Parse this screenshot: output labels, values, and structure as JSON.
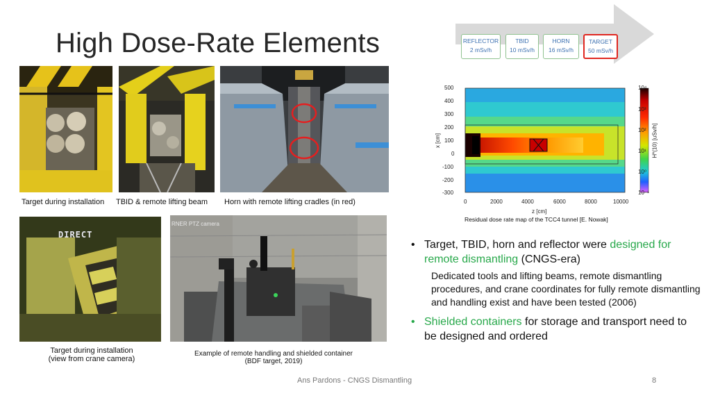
{
  "slide": {
    "title": "High Dose-Rate Elements",
    "footer_text": "Ans Pardons - CNGS Dismantling",
    "page_number": "8"
  },
  "photos": {
    "target_installation": {
      "caption": "Target during installation"
    },
    "tbid_beam": {
      "caption": "TBID & remote lifting beam"
    },
    "horn_cradles": {
      "caption": "Horn with remote lifting cradles (in red)"
    },
    "crane_camera": {
      "caption_line1": "Target during installation",
      "caption_line2": "(view from crane camera)",
      "overlay_text": "DIRECT"
    },
    "remote_handling": {
      "caption_line1": "Example of remote handling and shielded container",
      "caption_line2": "(BDF target, 2019)",
      "overlay_text": "RNER PTZ camera"
    }
  },
  "flow": {
    "stages": [
      {
        "name": "REFLECTOR",
        "dose": "2 mSv/h",
        "highlight": false
      },
      {
        "name": "TBID",
        "dose": "10 mSv/h",
        "highlight": false
      },
      {
        "name": "HORN",
        "dose": "16 mSv/h",
        "highlight": false
      },
      {
        "name": "TARGET",
        "dose": "50 mSv/h",
        "highlight": true
      }
    ],
    "colors": {
      "arrow": "#d9d9d9",
      "stage_border": "#8fc28f",
      "highlight_border": "#e0261f",
      "stage_text": "#3a6fb0"
    }
  },
  "dose_map": {
    "caption": "Residual dose rate map of the TCC4 tunnel [E. Nowak]",
    "x_axis_label": "z [cm]",
    "y_axis_label": "x [cm]",
    "colorbar_label": "H*(10) [uSv/h]",
    "y_ticks": [
      "500",
      "400",
      "300",
      "200",
      "100",
      "0",
      "-100",
      "-200",
      "-300"
    ],
    "x_ticks": [
      "0",
      "2000",
      "4000",
      "6000",
      "8000",
      "10000"
    ],
    "colorbar_ticks": [
      "10⁴",
      "10³",
      "10²",
      "10¹",
      "10⁰",
      "10⁻¹"
    ]
  },
  "bullets": [
    {
      "pre": "Target, TBID, horn and reflector were ",
      "highlight": "designed for remote dismantling",
      "post": " (CNGS-era)",
      "sub": "Dedicated tools and lifting beams, remote dismantling procedures, and crane coordinates for fully remote dismantling and handling exist and have been tested (2006)"
    },
    {
      "highlight": "Shielded containers",
      "post": " for storage and transport need to be designed and ordered"
    }
  ],
  "colors": {
    "accent_green": "#27a84a",
    "title": "#262626"
  }
}
